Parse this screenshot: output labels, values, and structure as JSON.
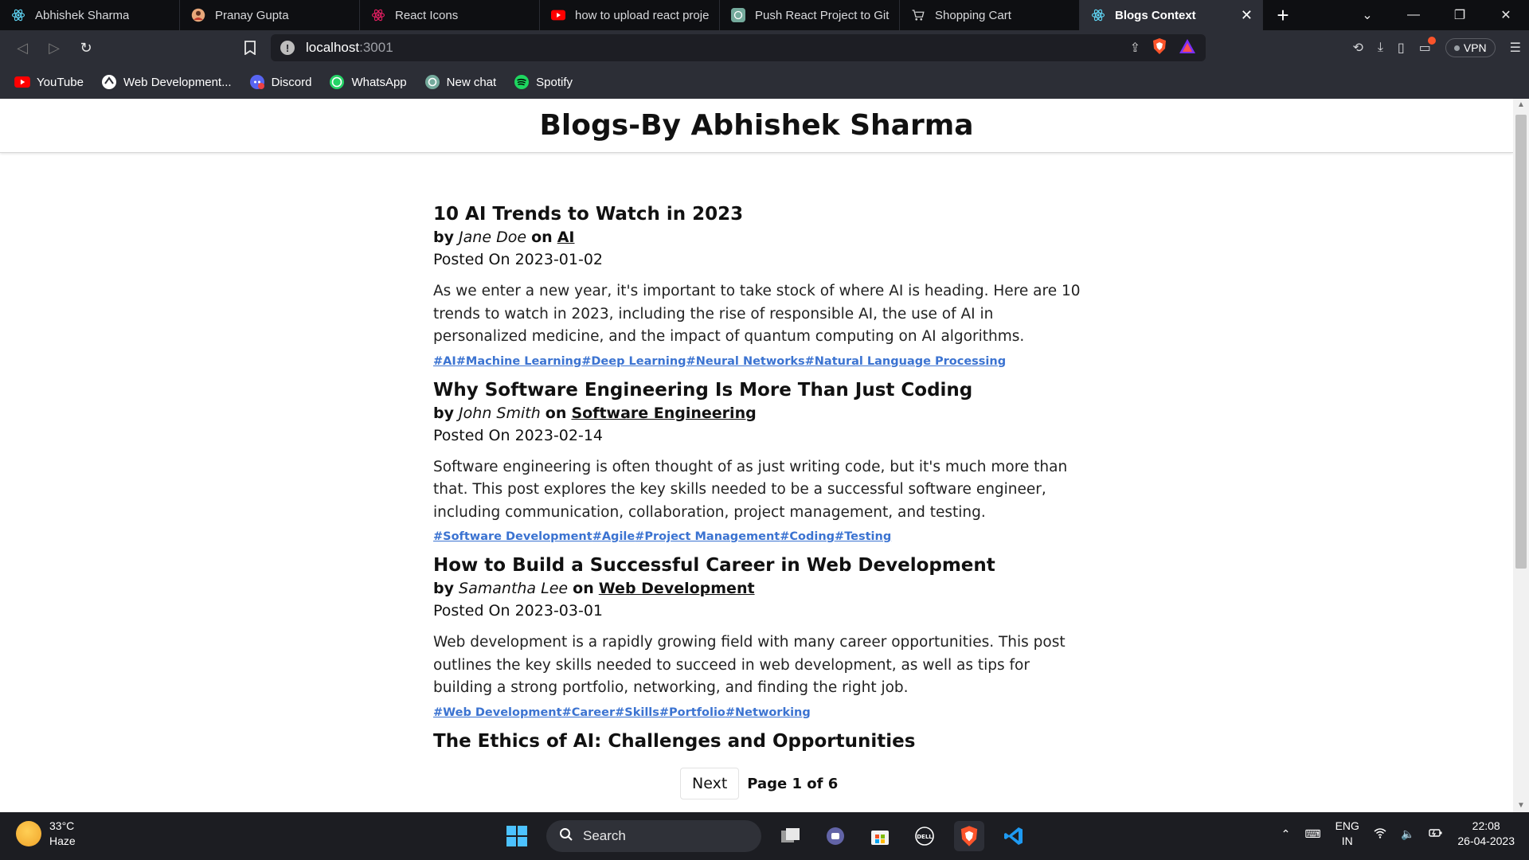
{
  "tabs": [
    {
      "title": "Abhishek Sharma",
      "icon": "react-icon"
    },
    {
      "title": "Pranay Gupta",
      "icon": "avatar-icon"
    },
    {
      "title": "React Icons",
      "icon": "react-icons-icon"
    },
    {
      "title": "how to upload react projec",
      "icon": "youtube-icon"
    },
    {
      "title": "Push React Project to GitHu",
      "icon": "chatgpt-icon"
    },
    {
      "title": "Shopping Cart",
      "icon": "cart-icon"
    },
    {
      "title": "Blogs Context",
      "icon": "react-icon",
      "active": true
    }
  ],
  "address": {
    "host": "localhost",
    "port": ":3001"
  },
  "toolbar": {
    "vpn_label": "VPN"
  },
  "bookmarks": [
    {
      "label": "YouTube",
      "icon": "youtube-icon"
    },
    {
      "label": "Web Development...",
      "icon": "web-icon"
    },
    {
      "label": "Discord",
      "icon": "discord-icon"
    },
    {
      "label": "WhatsApp",
      "icon": "whatsapp-icon"
    },
    {
      "label": "New chat",
      "icon": "chatgpt-icon"
    },
    {
      "label": "Spotify",
      "icon": "spotify-icon"
    }
  ],
  "page": {
    "title": "Blogs-By Abhishek Sharma",
    "posts": [
      {
        "title": "10 AI Trends to Watch in 2023",
        "by": "by",
        "author": "Jane Doe",
        "on": "on",
        "category": "AI",
        "posted_label": "Posted On",
        "date": "2023-01-02",
        "content": "As we enter a new year, it's important to take stock of where AI is heading. Here are 10 trends to watch in 2023, including the rise of responsible AI, the use of AI in personalized medicine, and the impact of quantum computing on AI algorithms.",
        "tags": [
          "#AI",
          "#Machine Learning",
          "#Deep Learning",
          "#Neural Networks",
          "#Natural Language Processing"
        ]
      },
      {
        "title": "Why Software Engineering Is More Than Just Coding",
        "by": "by",
        "author": "John Smith",
        "on": "on",
        "category": "Software Engineering",
        "posted_label": "Posted On",
        "date": "2023-02-14",
        "content": "Software engineering is often thought of as just writing code, but it's much more than that. This post explores the key skills needed to be a successful software engineer, including communication, collaboration, project management, and testing.",
        "tags": [
          "#Software Development",
          "#Agile",
          "#Project Management",
          "#Coding",
          "#Testing"
        ]
      },
      {
        "title": "How to Build a Successful Career in Web Development",
        "by": "by",
        "author": "Samantha Lee",
        "on": "on",
        "category": "Web Development",
        "posted_label": "Posted On",
        "date": "2023-03-01",
        "content": "Web development is a rapidly growing field with many career opportunities. This post outlines the key skills needed to succeed in web development, as well as tips for building a strong portfolio, networking, and finding the right job.",
        "tags": [
          "#Web Development",
          "#Career",
          "#Skills",
          "#Portfolio",
          "#Networking"
        ]
      },
      {
        "title": "The Ethics of AI: Challenges and Opportunities"
      }
    ],
    "pagination": {
      "next_label": "Next",
      "page_info": "Page 1 of 6"
    }
  },
  "taskbar": {
    "weather": {
      "temp": "33°C",
      "condition": "Haze"
    },
    "search_label": "Search",
    "lang": {
      "line1": "ENG",
      "line2": "IN"
    },
    "clock": {
      "time": "22:08",
      "date": "26-04-2023"
    }
  },
  "colors": {
    "tag_link": "#3b73d1",
    "tab_strip": "#0e0f12",
    "toolbar": "#2c2e36",
    "brave_orange": "#fb542b"
  }
}
